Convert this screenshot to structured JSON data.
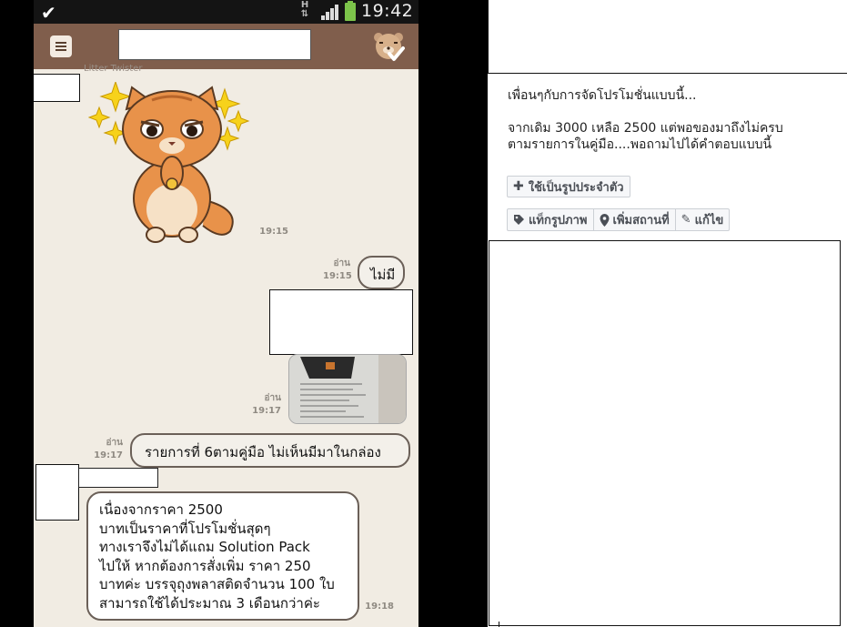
{
  "statusbar": {
    "network": "H",
    "time": "19:42"
  },
  "chat": {
    "sender_name": "Litter Twister",
    "messages": [
      {
        "type": "sticker",
        "time": "19:15"
      },
      {
        "type": "outgoing",
        "read": "อ่าน",
        "time": "19:15",
        "text": "ไม่มี"
      },
      {
        "type": "outgoing-photo",
        "read": "อ่าน",
        "time": "19:17"
      },
      {
        "type": "outgoing",
        "read": "อ่าน",
        "time": "19:17",
        "text": "รายการที่ 6ตามคู่มือ ไม่เห็นมีมาในกล่อง"
      },
      {
        "type": "incoming",
        "time": "19:18",
        "lines": [
          "เนื่องจากราคา 2500",
          "บาทเป็นราคาที่โปรโมชั่นสุดๆ",
          "ทางเราจึงไม่ได้แถม Solution Pack",
          "ไปให้ หากต้องการสั่งเพิ่ม ราคา 250",
          "บาทค่ะ บรรจุถุงพลาสติดจำนวน 100 ใบ",
          "สามารถใช้ได้ประมาณ 3 เดือนกว่าค่ะ"
        ]
      }
    ]
  },
  "facebook": {
    "caption_line1": "เพื่อนๆกับการจัดโปรโมชั่นแบบนี้...",
    "caption_line2": "จากเดิม 3000 เหลือ 2500 แต่พอของมาถึงไม่ครบ",
    "caption_line3": "ตามรายการในคู่มือ....พอถามไปได้คำตอบแบบนี้",
    "profile_button": "ใช้เป็นรูปประจำตัว",
    "tag_button": "แท็กรูปภาพ",
    "location_button": "เพิ่มสถานที่",
    "edit_button": "แก้ไข"
  },
  "colors": {
    "chat_bg": "#f1ece3",
    "chatbar": "#805e4c",
    "statusbar": "#141414",
    "bubble_border": "#6b6058"
  }
}
